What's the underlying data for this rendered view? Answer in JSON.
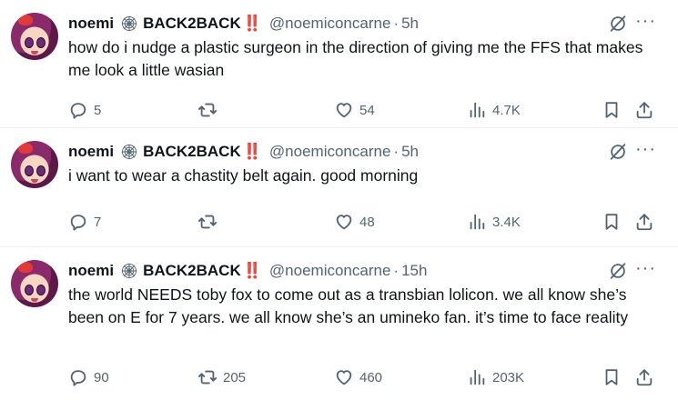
{
  "tweets": [
    {
      "name": "noemi",
      "display_suffix": "BACK2BACK",
      "badge": "‼️",
      "handle": "@noemiconcarne",
      "time": "5h",
      "text": "how do i nudge a plastic surgeon in the direction of giving me the FFS that makes me look a little wasian",
      "replies": "5",
      "retweets": "",
      "likes": "54",
      "views": "4.7K"
    },
    {
      "name": "noemi",
      "display_suffix": "BACK2BACK",
      "badge": "‼️",
      "handle": "@noemiconcarne",
      "time": "5h",
      "text": "i want to wear a chastity belt again. good morning",
      "replies": "7",
      "retweets": "",
      "likes": "48",
      "views": "3.4K"
    },
    {
      "name": "noemi",
      "display_suffix": "BACK2BACK",
      "badge": "‼️",
      "handle": "@noemiconcarne",
      "time": "15h",
      "text": "the world NEEDS toby fox to come out as a transbian lolicon. we all know she’s been on E for 7 years. we all know she’s an umineko fan. it’s time to face reality",
      "replies": "90",
      "retweets": "205",
      "likes": "460",
      "views": "203K"
    }
  ],
  "icons": {
    "reply": "reply-icon",
    "retweet": "retweet-icon",
    "like": "heart-icon",
    "views": "views-icon",
    "bookmark": "bookmark-icon",
    "share": "share-icon",
    "grok": "grok-icon",
    "more": "more-icon",
    "emoji": "spiderweb-icon"
  },
  "colors": {
    "text": "#0f1419",
    "muted": "#536471",
    "bang": "#e0245e",
    "divider": "#eff3f4"
  }
}
